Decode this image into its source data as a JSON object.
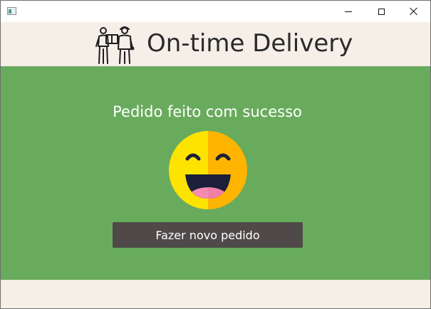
{
  "window": {
    "title_icon": "app-window-icon",
    "controls": [
      "minimize",
      "maximize",
      "close"
    ]
  },
  "header": {
    "brand": "On-time Delivery",
    "logo_icon": "delivery-people-icon"
  },
  "main": {
    "message": "Pedido feito com sucesso",
    "emoji_icon": "laughing-face-emoji",
    "button_label": "Fazer novo pedido"
  },
  "colors": {
    "header_bg": "#f5efe8",
    "main_bg": "#69ab5d",
    "button_bg": "#4f4a49",
    "brand_text": "#2a2a2a"
  }
}
